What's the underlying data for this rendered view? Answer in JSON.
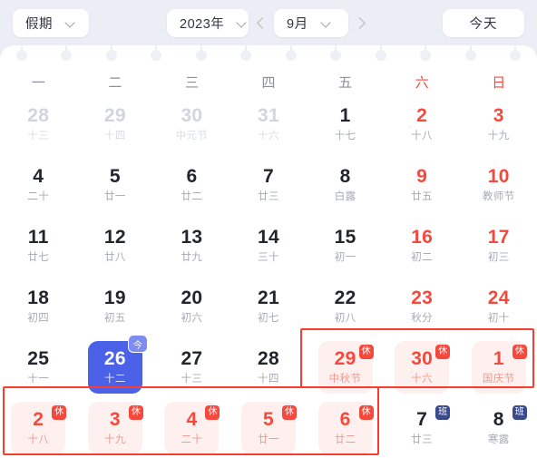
{
  "toolbar": {
    "holiday_select": {
      "value": "假期",
      "icon": "chevron-down-icon"
    },
    "year_select": {
      "value": "2023年",
      "icon": "chevron-down-icon"
    },
    "month_select": {
      "value": "9月",
      "icon": "chevron-down-icon"
    },
    "prev_label": "‹",
    "next_label": "›",
    "today_button": "今天"
  },
  "weekdays": [
    {
      "label": "一",
      "weekend": false
    },
    {
      "label": "二",
      "weekend": false
    },
    {
      "label": "三",
      "weekend": false
    },
    {
      "label": "四",
      "weekend": false
    },
    {
      "label": "五",
      "weekend": false
    },
    {
      "label": "六",
      "weekend": true
    },
    {
      "label": "日",
      "weekend": true
    }
  ],
  "colors": {
    "accent_red": "#f5493d",
    "selected_blue": "#4b62e8",
    "today_badge_blue": "#7c8cf0",
    "work_badge_blue": "#3b4a8c",
    "rest_cell_bg": "#fdf0ee",
    "page_bg": "#eceef5",
    "card_bg": "#ffffff"
  },
  "badges": {
    "rest": "休",
    "work": "班",
    "today": "今"
  },
  "weeks": [
    [
      {
        "day": "28",
        "lunar": "十三",
        "state": "muted"
      },
      {
        "day": "29",
        "lunar": "十四",
        "state": "muted"
      },
      {
        "day": "30",
        "lunar": "中元节",
        "state": "muted"
      },
      {
        "day": "31",
        "lunar": "十六",
        "state": "muted"
      },
      {
        "day": "1",
        "lunar": "十七",
        "state": "normal"
      },
      {
        "day": "2",
        "lunar": "十八",
        "state": "weekend"
      },
      {
        "day": "3",
        "lunar": "十九",
        "state": "weekend"
      }
    ],
    [
      {
        "day": "4",
        "lunar": "二十",
        "state": "normal"
      },
      {
        "day": "5",
        "lunar": "廿一",
        "state": "normal"
      },
      {
        "day": "6",
        "lunar": "廿二",
        "state": "normal"
      },
      {
        "day": "7",
        "lunar": "廿三",
        "state": "normal"
      },
      {
        "day": "8",
        "lunar": "白露",
        "state": "normal"
      },
      {
        "day": "9",
        "lunar": "廿五",
        "state": "weekend"
      },
      {
        "day": "10",
        "lunar": "教师节",
        "state": "weekend"
      }
    ],
    [
      {
        "day": "11",
        "lunar": "廿七",
        "state": "normal"
      },
      {
        "day": "12",
        "lunar": "廿八",
        "state": "normal"
      },
      {
        "day": "13",
        "lunar": "廿九",
        "state": "normal"
      },
      {
        "day": "14",
        "lunar": "三十",
        "state": "normal"
      },
      {
        "day": "15",
        "lunar": "初一",
        "state": "normal"
      },
      {
        "day": "16",
        "lunar": "初二",
        "state": "weekend"
      },
      {
        "day": "17",
        "lunar": "初三",
        "state": "weekend"
      }
    ],
    [
      {
        "day": "18",
        "lunar": "初四",
        "state": "normal"
      },
      {
        "day": "19",
        "lunar": "初五",
        "state": "normal"
      },
      {
        "day": "20",
        "lunar": "初六",
        "state": "normal"
      },
      {
        "day": "21",
        "lunar": "初七",
        "state": "normal"
      },
      {
        "day": "22",
        "lunar": "初八",
        "state": "normal"
      },
      {
        "day": "23",
        "lunar": "秋分",
        "state": "weekend"
      },
      {
        "day": "24",
        "lunar": "初十",
        "state": "weekend"
      }
    ],
    [
      {
        "day": "25",
        "lunar": "十一",
        "state": "normal"
      },
      {
        "day": "26",
        "lunar": "十二",
        "state": "selected",
        "badge": "today"
      },
      {
        "day": "27",
        "lunar": "十三",
        "state": "normal"
      },
      {
        "day": "28",
        "lunar": "十四",
        "state": "normal"
      },
      {
        "day": "29",
        "lunar": "中秋节",
        "state": "rest",
        "badge": "rest"
      },
      {
        "day": "30",
        "lunar": "十六",
        "state": "rest",
        "badge": "rest"
      },
      {
        "day": "1",
        "lunar": "国庆节",
        "state": "rest",
        "badge": "rest"
      }
    ],
    [
      {
        "day": "2",
        "lunar": "十八",
        "state": "rest",
        "badge": "rest"
      },
      {
        "day": "3",
        "lunar": "十九",
        "state": "rest",
        "badge": "rest"
      },
      {
        "day": "4",
        "lunar": "二十",
        "state": "rest",
        "badge": "rest"
      },
      {
        "day": "5",
        "lunar": "廿一",
        "state": "rest",
        "badge": "rest"
      },
      {
        "day": "6",
        "lunar": "廿二",
        "state": "rest",
        "badge": "rest"
      },
      {
        "day": "7",
        "lunar": "廿三",
        "state": "normal",
        "badge": "work"
      },
      {
        "day": "8",
        "lunar": "寒露",
        "state": "normal",
        "badge": "work"
      }
    ]
  ],
  "pin_count": 12
}
